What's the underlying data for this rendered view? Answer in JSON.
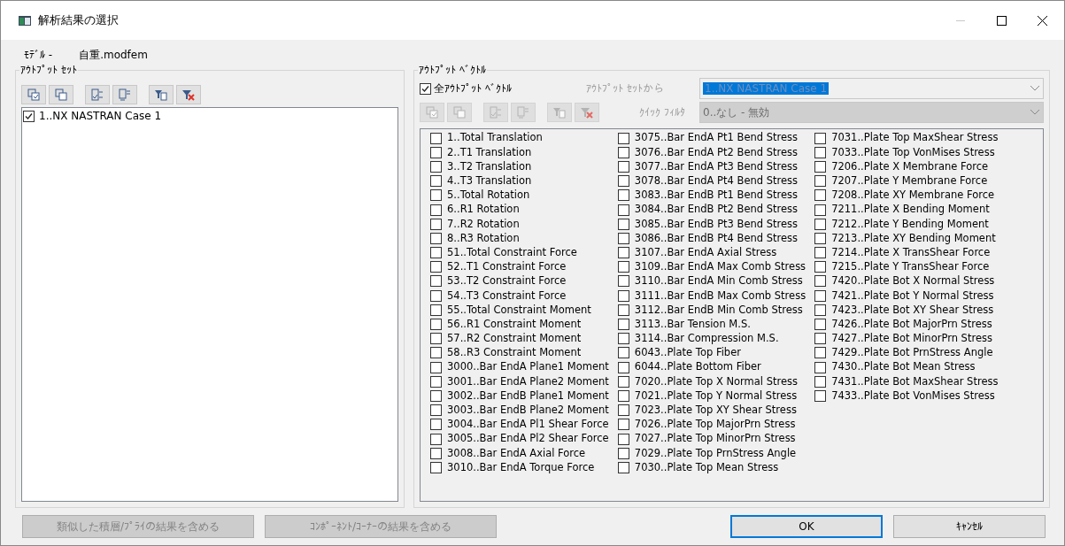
{
  "window": {
    "title": "解析結果の選択",
    "minimize_disabled": true
  },
  "model": {
    "label": "ﾓﾃﾞﾙ -",
    "value": "自重.modfem"
  },
  "output_sets": {
    "title": "ｱｳﾄﾌﾟｯﾄ ｾｯﾄ",
    "toolbar_disabled": false,
    "items": [
      {
        "label": "1..NX NASTRAN Case 1",
        "checked": true
      }
    ]
  },
  "output_vectors": {
    "title": "ｱｳﾄﾌﾟｯﾄ ﾍﾞｸﾄﾙ",
    "all": {
      "label": "全ｱｳﾄﾌﾟｯﾄ ﾍﾞｸﾄﾙ",
      "checked": true
    },
    "from_set": {
      "label": "ｱｳﾄﾌﾟｯﾄ ｾｯﾄから",
      "value": "1..NX NASTRAN Case 1",
      "disabled": true
    },
    "toolbar_disabled": true,
    "quick_filter": {
      "label": "ｸｲｯｸ ﾌｨﾙﾀ",
      "value": "0..なし - 無効",
      "disabled": true
    },
    "items": [
      {
        "label": "1..Total Translation",
        "checked": false
      },
      {
        "label": "2..T1 Translation",
        "checked": false
      },
      {
        "label": "3..T2 Translation",
        "checked": false
      },
      {
        "label": "4..T3 Translation",
        "checked": false
      },
      {
        "label": "5..Total Rotation",
        "checked": false
      },
      {
        "label": "6..R1 Rotation",
        "checked": false
      },
      {
        "label": "7..R2 Rotation",
        "checked": false
      },
      {
        "label": "8..R3 Rotation",
        "checked": false
      },
      {
        "label": "51..Total Constraint Force",
        "checked": false
      },
      {
        "label": "52..T1 Constraint Force",
        "checked": false
      },
      {
        "label": "53..T2 Constraint Force",
        "checked": false
      },
      {
        "label": "54..T3 Constraint Force",
        "checked": false
      },
      {
        "label": "55..Total Constraint Moment",
        "checked": false
      },
      {
        "label": "56..R1 Constraint Moment",
        "checked": false
      },
      {
        "label": "57..R2 Constraint Moment",
        "checked": false
      },
      {
        "label": "58..R3 Constraint Moment",
        "checked": false
      },
      {
        "label": "3000..Bar EndA Plane1 Moment",
        "checked": false
      },
      {
        "label": "3001..Bar EndA Plane2 Moment",
        "checked": false
      },
      {
        "label": "3002..Bar EndB Plane1 Moment",
        "checked": false
      },
      {
        "label": "3003..Bar EndB Plane2 Moment",
        "checked": false
      },
      {
        "label": "3004..Bar EndA Pl1 Shear Force",
        "checked": false
      },
      {
        "label": "3005..Bar EndA Pl2 Shear Force",
        "checked": false
      },
      {
        "label": "3008..Bar EndA Axial Force",
        "checked": false
      },
      {
        "label": "3010..Bar EndA Torque Force",
        "checked": false
      },
      {
        "label": "3075..Bar EndA Pt1 Bend Stress",
        "checked": false
      },
      {
        "label": "3076..Bar EndA Pt2 Bend Stress",
        "checked": false
      },
      {
        "label": "3077..Bar EndA Pt3 Bend Stress",
        "checked": false
      },
      {
        "label": "3078..Bar EndA Pt4 Bend Stress",
        "checked": false
      },
      {
        "label": "3083..Bar EndB Pt1 Bend Stress",
        "checked": false
      },
      {
        "label": "3084..Bar EndB Pt2 Bend Stress",
        "checked": false
      },
      {
        "label": "3085..Bar EndB Pt3 Bend Stress",
        "checked": false
      },
      {
        "label": "3086..Bar EndB Pt4 Bend Stress",
        "checked": false
      },
      {
        "label": "3107..Bar EndA Axial Stress",
        "checked": false
      },
      {
        "label": "3109..Bar EndA Max Comb Stress",
        "checked": false
      },
      {
        "label": "3110..Bar EndA Min Comb Stress",
        "checked": false
      },
      {
        "label": "3111..Bar EndB Max Comb Stress",
        "checked": false
      },
      {
        "label": "3112..Bar EndB Min Comb Stress",
        "checked": false
      },
      {
        "label": "3113..Bar Tension M.S.",
        "checked": false
      },
      {
        "label": "3114..Bar Compression M.S.",
        "checked": false
      },
      {
        "label": "6043..Plate Top Fiber",
        "checked": false
      },
      {
        "label": "6044..Plate Bottom Fiber",
        "checked": false
      },
      {
        "label": "7020..Plate Top X Normal Stress",
        "checked": false
      },
      {
        "label": "7021..Plate Top Y Normal Stress",
        "checked": false
      },
      {
        "label": "7023..Plate Top XY Shear Stress",
        "checked": false
      },
      {
        "label": "7026..Plate Top MajorPrn Stress",
        "checked": false
      },
      {
        "label": "7027..Plate Top MinorPrn Stress",
        "checked": false
      },
      {
        "label": "7029..Plate Top PrnStress Angle",
        "checked": false
      },
      {
        "label": "7030..Plate Top Mean Stress",
        "checked": false
      },
      {
        "label": "7031..Plate Top MaxShear Stress",
        "checked": false
      },
      {
        "label": "7033..Plate Top VonMises Stress",
        "checked": false
      },
      {
        "label": "7206..Plate X Membrane Force",
        "checked": false
      },
      {
        "label": "7207..Plate Y Membrane Force",
        "checked": false
      },
      {
        "label": "7208..Plate XY Membrane Force",
        "checked": false
      },
      {
        "label": "7211..Plate X Bending Moment",
        "checked": false
      },
      {
        "label": "7212..Plate Y Bending Moment",
        "checked": false
      },
      {
        "label": "7213..Plate XY Bending Moment",
        "checked": false
      },
      {
        "label": "7214..Plate X TransShear Force",
        "checked": false
      },
      {
        "label": "7215..Plate Y TransShear Force",
        "checked": false
      },
      {
        "label": "7420..Plate Bot X Normal Stress",
        "checked": false
      },
      {
        "label": "7421..Plate Bot Y Normal Stress",
        "checked": false
      },
      {
        "label": "7423..Plate Bot XY Shear Stress",
        "checked": false
      },
      {
        "label": "7426..Plate Bot MajorPrn Stress",
        "checked": false
      },
      {
        "label": "7427..Plate Bot MinorPrn Stress",
        "checked": false
      },
      {
        "label": "7429..Plate Bot PrnStress Angle",
        "checked": false
      },
      {
        "label": "7430..Plate Bot Mean Stress",
        "checked": false
      },
      {
        "label": "7431..Plate Bot MaxShear Stress",
        "checked": false
      },
      {
        "label": "7433..Plate Bot VonMises Stress",
        "checked": false
      }
    ]
  },
  "buttons": [
    {
      "label": "類似した積層/ﾌﾟﾗｲの結果を含める",
      "disabled": true,
      "default": false
    },
    {
      "label": "ｺﾝﾎﾟｰﾈﾝﾄ/ｺｰﾅｰの結果を含める",
      "disabled": true,
      "default": false
    },
    {
      "label": "OK",
      "disabled": false,
      "default": true
    },
    {
      "label": "ｷｬﾝｾﾙ",
      "disabled": false,
      "default": false
    }
  ]
}
